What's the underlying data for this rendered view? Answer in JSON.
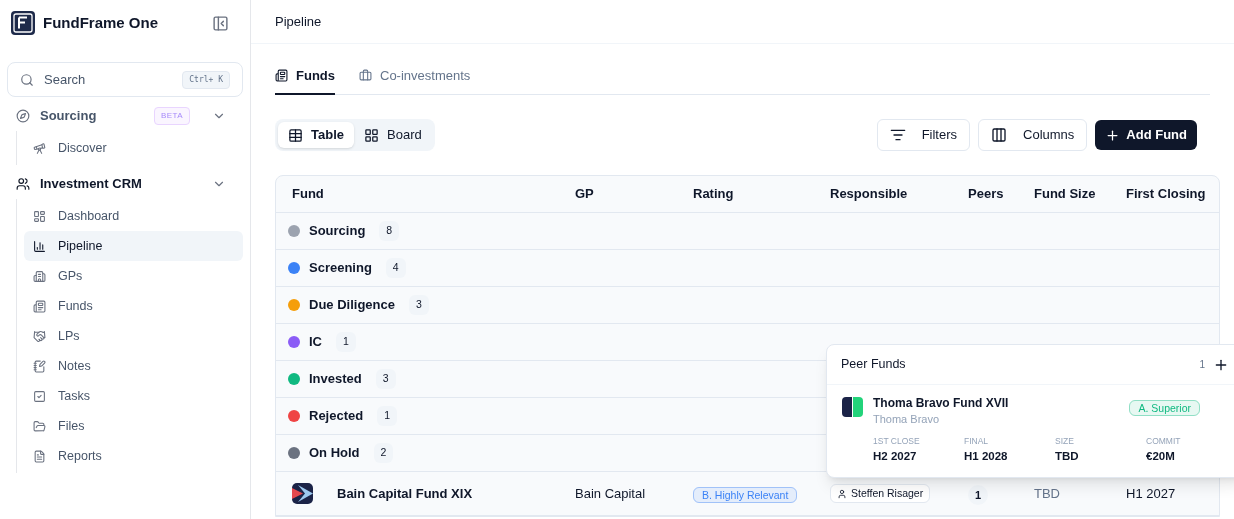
{
  "app": {
    "name": "FundFrame One"
  },
  "sidebar": {
    "search": {
      "placeholder": "Search",
      "shortcut": "Ctrl+ K"
    },
    "sections": [
      {
        "label": "Sourcing",
        "badge": "BETA",
        "expanded": true,
        "items": [
          {
            "label": "Discover",
            "selected": false
          }
        ]
      },
      {
        "label": "Investment CRM",
        "expanded": true,
        "items": [
          {
            "label": "Dashboard",
            "selected": false
          },
          {
            "label": "Pipeline",
            "selected": true
          },
          {
            "label": "GPs",
            "selected": false
          },
          {
            "label": "Funds",
            "selected": false
          },
          {
            "label": "LPs",
            "selected": false
          },
          {
            "label": "Notes",
            "selected": false
          },
          {
            "label": "Tasks",
            "selected": false
          },
          {
            "label": "Files",
            "selected": false
          },
          {
            "label": "Reports",
            "selected": false
          }
        ]
      }
    ]
  },
  "header": {
    "title": "Pipeline"
  },
  "tabs": [
    {
      "label": "Funds",
      "selected": true
    },
    {
      "label": "Co-investments",
      "selected": false
    }
  ],
  "view_toggle": [
    {
      "label": "Table",
      "selected": true
    },
    {
      "label": "Board",
      "selected": false
    }
  ],
  "actions": [
    {
      "label": "Filters",
      "kind": "filter"
    },
    {
      "label": "Columns",
      "kind": "columns"
    },
    {
      "label": "Add Fund",
      "kind": "primary"
    }
  ],
  "table": {
    "columns": [
      "Fund",
      "GP",
      "Rating",
      "Responsible",
      "Peers",
      "Fund Size",
      "First Closing"
    ],
    "groups": [
      {
        "label": "Sourcing",
        "count": "8",
        "color": "#9ca3af"
      },
      {
        "label": "Screening",
        "count": "4",
        "color": "#3b82f6"
      },
      {
        "label": "Due Diligence",
        "count": "3",
        "color": "#f59e0b"
      },
      {
        "label": "IC",
        "count": "1",
        "color": "#8b5cf6"
      },
      {
        "label": "Invested",
        "count": "3",
        "color": "#10b981"
      },
      {
        "label": "Rejected",
        "count": "1",
        "color": "#ef4444"
      },
      {
        "label": "On Hold",
        "count": "2",
        "color": "#6b7280"
      }
    ],
    "rows": [
      {
        "fund": "Bain Capital Fund XIX",
        "gp": "Bain Capital",
        "rating": {
          "label": "B. Highly Relevant",
          "color": "#3b82f6"
        },
        "responsible": "Steffen Risager",
        "peers": "1",
        "fund_size": "TBD",
        "first_closing": "H1 2027"
      }
    ]
  },
  "peer_popover": {
    "title": "Peer Funds",
    "count": "1",
    "funds": [
      {
        "name": "Thoma Bravo Fund XVII",
        "gp": "Thoma Bravo",
        "rating": {
          "label": "A. Superior",
          "color": "#10b981"
        },
        "stats": [
          {
            "label": "1ST CLOSE",
            "value": "H2 2027"
          },
          {
            "label": "FINAL",
            "value": "H1 2028"
          },
          {
            "label": "SIZE",
            "value": "TBD"
          },
          {
            "label": "COMMIT",
            "value": "€20M"
          }
        ]
      }
    ]
  }
}
